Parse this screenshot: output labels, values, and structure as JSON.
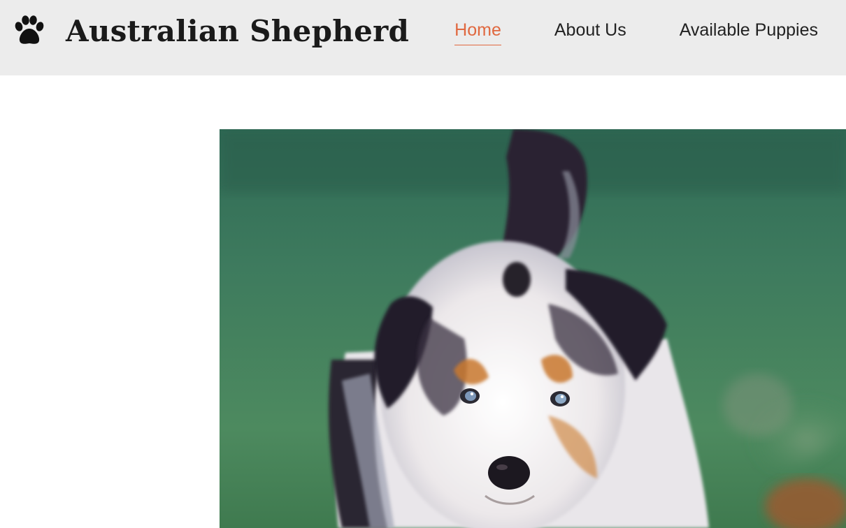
{
  "site": {
    "title": "Australian Shepherd",
    "logo_icon": "paw-icon"
  },
  "nav": {
    "items": [
      {
        "label": "Home",
        "active": true
      },
      {
        "label": "About Us",
        "active": false
      },
      {
        "label": "Available Puppies",
        "active": false
      }
    ],
    "accent_color": "#e0683f"
  },
  "hero": {
    "image_subject": "blue merle australian shepherd puppy on grass"
  }
}
